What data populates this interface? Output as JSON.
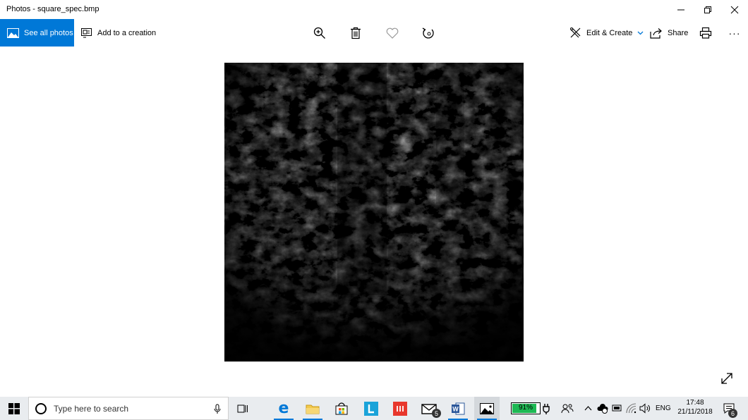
{
  "window": {
    "title": "Photos - square_spec.bmp"
  },
  "toolbar": {
    "see_all_label": "See all photos",
    "add_creation_label": "Add to a creation",
    "edit_create_label": "Edit & Create",
    "share_label": "Share",
    "more_label": "···"
  },
  "taskbar": {
    "search_placeholder": "Type here to search",
    "battery_percent": "91%",
    "battery_level": 0.91,
    "language": "ENG",
    "time": "17:48",
    "date": "21/11/2018",
    "mail_badge": "5",
    "notification_badge": "6"
  },
  "colors": {
    "accent": "#0078d7",
    "battery_green": "#1db954",
    "taskbar_bg": "#e9ecef"
  }
}
